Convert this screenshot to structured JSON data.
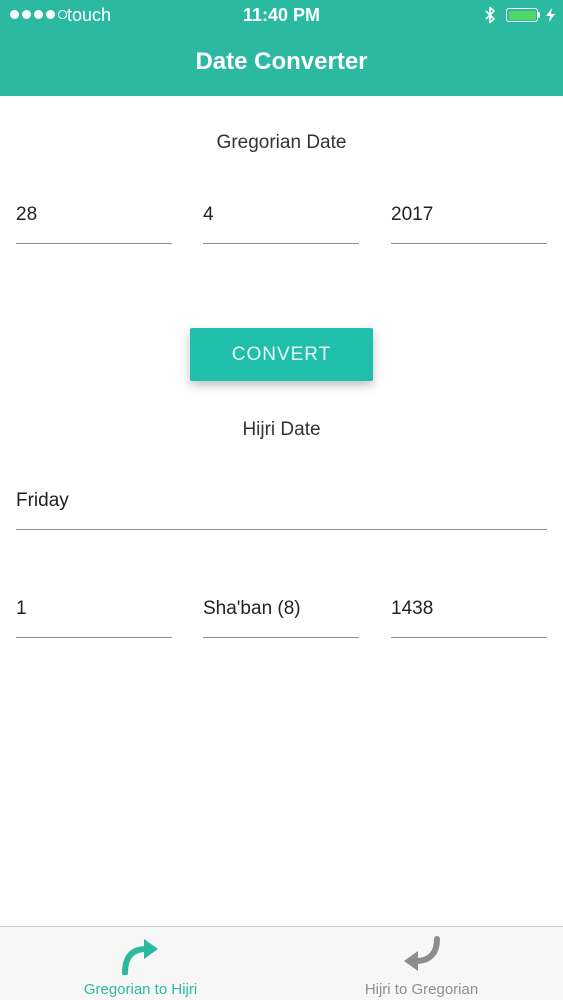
{
  "status_bar": {
    "carrier": "touch",
    "time": "11:40 PM"
  },
  "header": {
    "title": "Date Converter"
  },
  "gregorian": {
    "label": "Gregorian Date",
    "day": "28",
    "month": "4",
    "year": "2017"
  },
  "convert_button": {
    "label": "CONVERT"
  },
  "hijri": {
    "label": "Hijri Date",
    "weekday": "Friday",
    "day": "1",
    "month": "Sha'ban (8)",
    "year": "1438"
  },
  "tabs": [
    {
      "label": "Gregorian to Hijri",
      "icon": "forward-arrow-icon",
      "active": true
    },
    {
      "label": "Hijri to Gregorian",
      "icon": "back-arrow-icon",
      "active": false
    }
  ],
  "colors": {
    "primary": "#2bb9a2",
    "button": "#1fbfab",
    "tab_active": "#2bb9a2",
    "tab_inactive": "#8e8e8e",
    "battery": "#4cd964"
  }
}
